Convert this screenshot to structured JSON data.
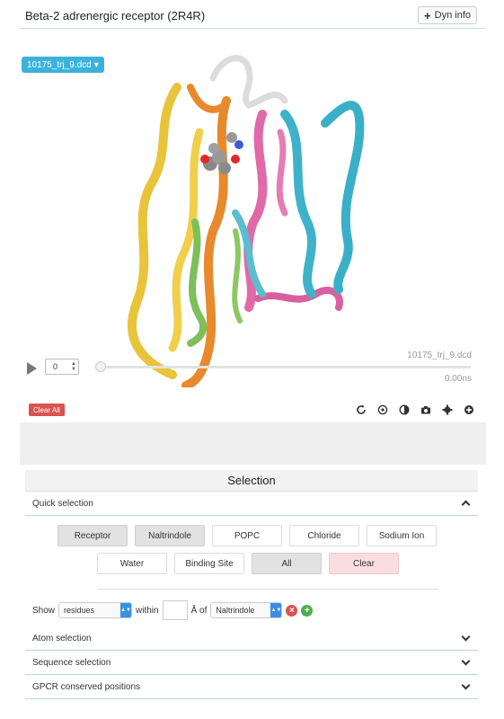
{
  "header": {
    "title": "Beta-2 adrenergic receptor (2R4R)",
    "dyn_info_label": "Dyn info"
  },
  "viewer": {
    "trajectory_dropdown": "10175_trj_9.dcd",
    "frame_value": "0",
    "trajectory_name": "10175_trj_9.dcd",
    "time_label": "0.00ns",
    "progress": 0
  },
  "toolbar": {
    "clear_all_label": "Clear All",
    "icons": [
      "refresh-icon",
      "target-icon",
      "contrast-icon",
      "camera-icon",
      "gear-icon",
      "plus-circle-icon"
    ]
  },
  "selection": {
    "title": "Selection",
    "quick_selection_label": "Quick selection",
    "buttons_row1": [
      "Receptor",
      "Naltrindole",
      "POPC",
      "Chloride",
      "Sodium Ion"
    ],
    "buttons_row2": [
      "Water",
      "Binding Site",
      "All",
      "Clear"
    ],
    "show_label": "Show",
    "show_value": "residues",
    "within_label": "within",
    "unit_label": "Å of",
    "of_value": "Naltrindole"
  },
  "accordions": [
    "Atom selection",
    "Sequence selection",
    "GPCR conserved positions"
  ]
}
